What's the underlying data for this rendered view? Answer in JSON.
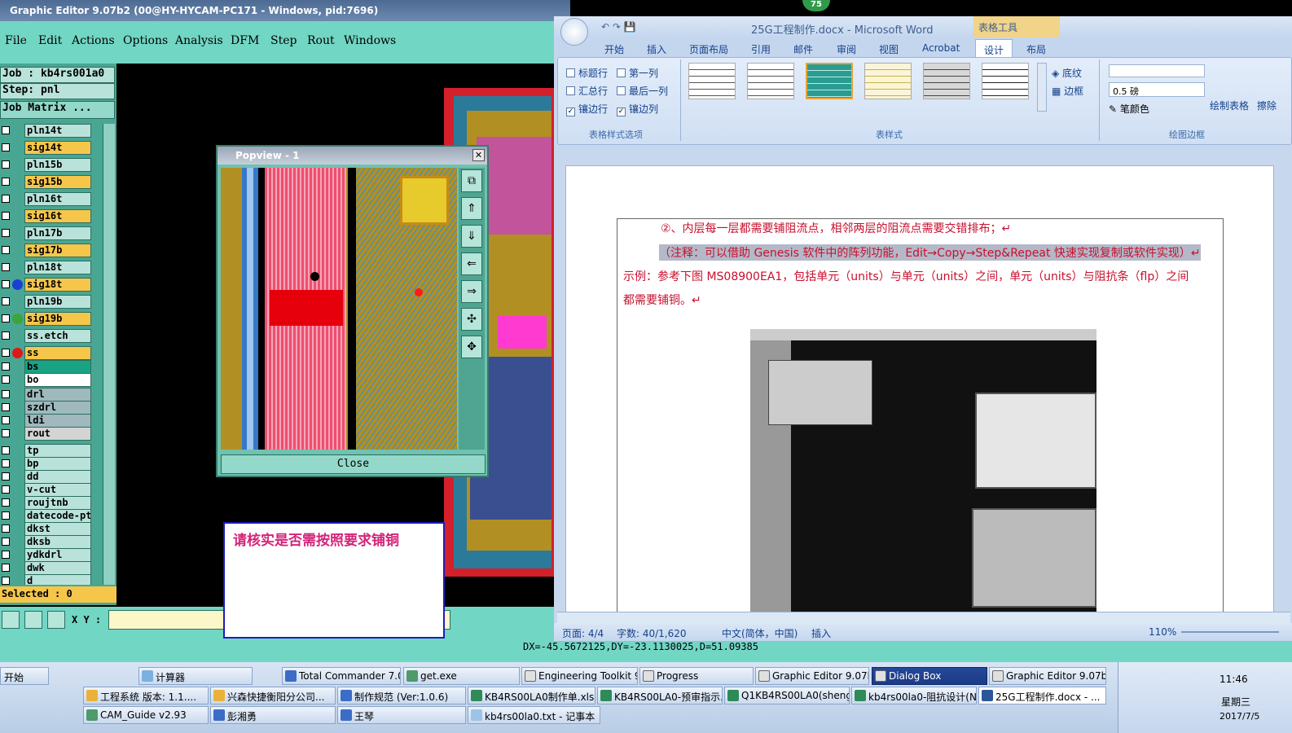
{
  "graphic_editor": {
    "title": "Graphic Editor 9.07b2 (00@HY-HYCAM-PC171 - Windows, pid:7696)",
    "menu": [
      "File",
      "Edit",
      "Actions",
      "Options",
      "Analysis",
      "DFM",
      "Step",
      "Rout",
      "Windows"
    ],
    "job_label": "Job : kb4rs001a0",
    "step_label": "Step: pnl",
    "job_matrix": "Job Matrix ...",
    "layers": [
      {
        "name": "pln14t",
        "color": "#b9e3da"
      },
      {
        "name": "sig14t",
        "color": "#f6c64b"
      },
      {
        "name": "pln15b",
        "color": "#b9e3da"
      },
      {
        "name": "sig15b",
        "color": "#f6c64b"
      },
      {
        "name": "pln16t",
        "color": "#b9e3da"
      },
      {
        "name": "sig16t",
        "color": "#f6c64b"
      },
      {
        "name": "pln17b",
        "color": "#b9e3da"
      },
      {
        "name": "sig17b",
        "color": "#f6c64b"
      },
      {
        "name": "pln18t",
        "color": "#b9e3da"
      },
      {
        "name": "sig18t",
        "color": "#f6c64b",
        "dot": "#1a3dd6"
      },
      {
        "name": "pln19b",
        "color": "#b9e3da"
      },
      {
        "name": "sig19b",
        "color": "#f6c64b",
        "dot": "#3aa63a"
      },
      {
        "name": "ss.etch",
        "color": "#b9e3da"
      },
      {
        "name": "ss",
        "color": "#f6c64b",
        "dot": "#e01818"
      },
      {
        "name": "bs",
        "color": "#1aa382"
      },
      {
        "name": "bo",
        "color": "#ffffff"
      },
      {
        "name": "drl",
        "color": "#9fb9bd"
      },
      {
        "name": "szdrl",
        "color": "#9fb9bd"
      },
      {
        "name": "ldi",
        "color": "#9fb9bd"
      },
      {
        "name": "rout",
        "color": "#d4d4d4"
      },
      {
        "name": "tp",
        "color": "#b9e3da"
      },
      {
        "name": "bp",
        "color": "#b9e3da"
      },
      {
        "name": "dd",
        "color": "#b9e3da"
      },
      {
        "name": "v-cut",
        "color": "#b9e3da"
      },
      {
        "name": "roujtnb",
        "color": "#b9e3da"
      },
      {
        "name": "datecode-ptc",
        "color": "#b9e3da"
      },
      {
        "name": "dkst",
        "color": "#b9e3da"
      },
      {
        "name": "dksb",
        "color": "#b9e3da"
      },
      {
        "name": "ydkdrl",
        "color": "#b9e3da"
      },
      {
        "name": "dwk",
        "color": "#b9e3da"
      },
      {
        "name": "d",
        "color": "#b9e3da"
      }
    ],
    "selected": "Selected : 0",
    "xy_label": "X Y :",
    "dx_readout": "DX=-45.5672125,DY=-23.1130025,D=51.09385"
  },
  "popview": {
    "title": "Popview - 1",
    "close_label": "Close",
    "close_x": "✕"
  },
  "message": "请核实是否需按照要求铺铜",
  "badge": "75",
  "word": {
    "title": "25G工程制作.docx - Microsoft Word",
    "context_tab": "表格工具",
    "tabs": [
      "开始",
      "插入",
      "页面布局",
      "引用",
      "邮件",
      "审阅",
      "视图",
      "Acrobat",
      "设计",
      "布局"
    ],
    "active_tab": "设计",
    "style_options": [
      {
        "label": "标题行",
        "checked": false
      },
      {
        "label": "第一列",
        "checked": false
      },
      {
        "label": "汇总行",
        "checked": false
      },
      {
        "label": "最后一列",
        "checked": false
      },
      {
        "label": "镶边行",
        "checked": true
      },
      {
        "label": "镶边列",
        "checked": true
      }
    ],
    "groups": [
      "表格样式选项",
      "表样式",
      "绘图边框"
    ],
    "shading_label": "底纹",
    "border_label": "边框",
    "pen_weight": "0.5 磅",
    "pen_color": "笔颜色",
    "draw_table": "绘制表格",
    "erase": "擦除",
    "doc_lines": [
      "②、内层每一层都需要铺阻流点，相邻两层的阻流点需要交错排布；↵",
      "（注释：可以借助 Genesis 软件中的阵列功能，Edit→Copy→Step&Repeat 快速实现复制或软件实现）↵",
      "示例：参考下图 MS08900EA1，包括单元（units）与单元（units）之间，单元（units）与阻抗条（flp）之间",
      "都需要铺铜。↵"
    ],
    "status": {
      "page": "页面: 4/4",
      "words": "字数: 40/1,620",
      "lang": "中文(简体，中国)",
      "mode": "插入",
      "zoom": "110%"
    }
  },
  "taskbar": {
    "start": "开始",
    "row1": [
      "计算器",
      "Total Commander 7.0 ...",
      "get.exe",
      "Engineering Toolkit 9....",
      "Progress",
      "Graphic Editor 9.07b2...",
      "Dialog Box",
      "Graphic Editor 9.07b2..."
    ],
    "row2": [
      "工程系统  版本: 1.1....",
      "兴森快捷衡阳分公司...",
      "制作规范 (Ver:1.0.6)",
      "KB4RS00LA0制作单.xls ...",
      "KB4RS00LA0-预审指示...",
      "Q1KB4RS00LA0(shengc)...",
      "kb4rs00la0-阻抗设计(N...",
      "25G工程制作.docx - ..."
    ],
    "row3": [
      "CAM_Guide v2.93",
      "彭湘勇",
      "王琴",
      "kb4rs00la0.txt - 记事本"
    ],
    "active_row1": "Dialog Box",
    "active_row2": "25G工程制作.docx - ...",
    "clock_time": "11:46",
    "clock_day": "星期三",
    "clock_date": "2017/7/5"
  }
}
